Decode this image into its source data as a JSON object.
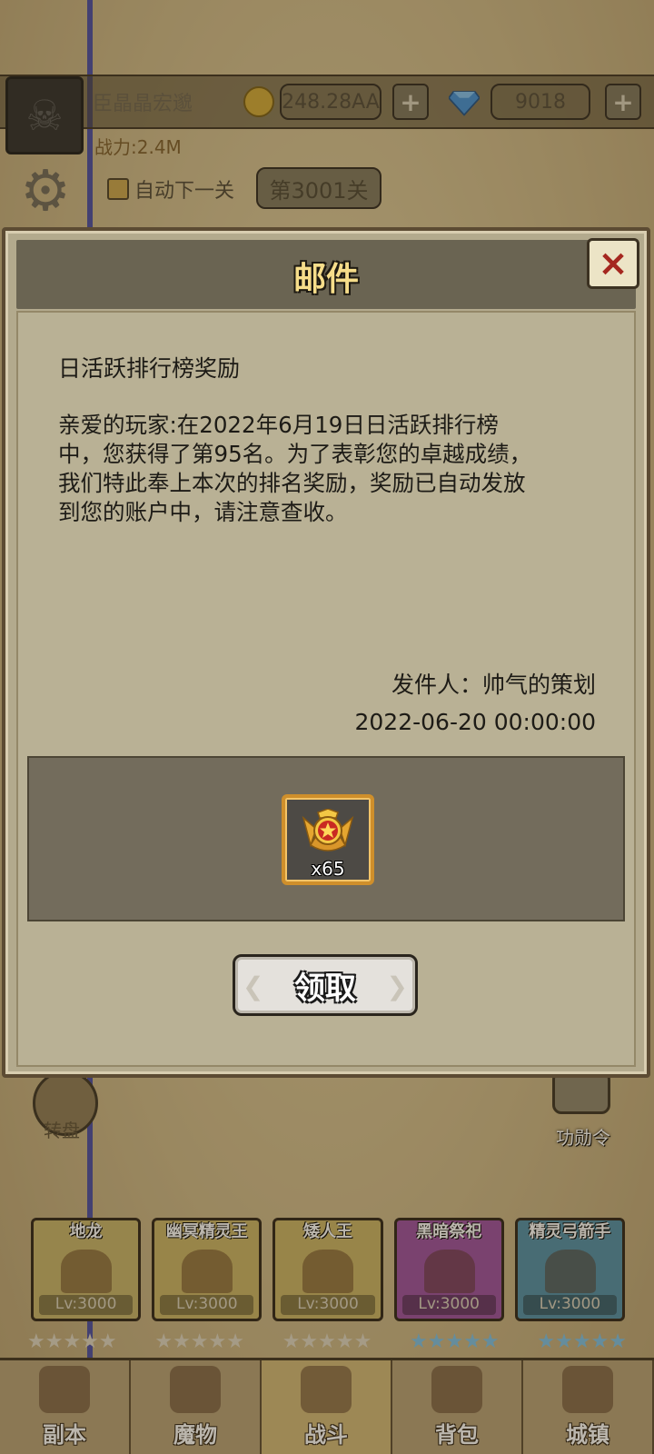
{
  "background": {
    "player_name": "臣晶晶宏邈",
    "gold_amount": "248.28AA",
    "gem_amount": "9018",
    "power_label": "战力:2.4M",
    "auto_next_label": "自动下一关",
    "stage_label": "第3001关",
    "left_side_button_label": "转盘",
    "right_side_button_label": "功勋令",
    "heroes": [
      {
        "name": "地龙",
        "level": "Lv:3000",
        "color": "#c7b46a"
      },
      {
        "name": "幽冥精灵王",
        "level": "Lv:3000",
        "color": "#c9b466"
      },
      {
        "name": "矮人王",
        "level": "Lv:3000",
        "color": "#c9b466"
      },
      {
        "name": "黑暗祭祀",
        "level": "Lv:3000",
        "color": "#9b4ea0"
      },
      {
        "name": "精灵弓箭手",
        "level": "Lv:3000",
        "color": "#4f8ea8"
      }
    ],
    "nav_tabs": [
      {
        "label": "副本"
      },
      {
        "label": "魔物"
      },
      {
        "label": "战斗"
      },
      {
        "label": "背包"
      },
      {
        "label": "城镇"
      }
    ]
  },
  "modal": {
    "title": "邮件",
    "close_icon": "×",
    "mail": {
      "subject": "日活跃排行榜奖励",
      "body": "亲爱的玩家:在2022年6月19日日活跃排行榜\n中，您获得了第95名。为了表彰您的卓越成绩，\n我们特此奉上本次的排名奖励，奖励已自动发放\n到您的账户中，请注意查收。",
      "sender": "发件人：帅气的策划",
      "date": "2022-06-20 00:00:00"
    },
    "reward": {
      "icon": "medal-icon",
      "quantity": "x65"
    },
    "claim_label": "领取"
  },
  "colors": {
    "title_gold": "#f6dd8a",
    "close_red": "#a5271f",
    "reward_border": "#cf8f2b"
  }
}
